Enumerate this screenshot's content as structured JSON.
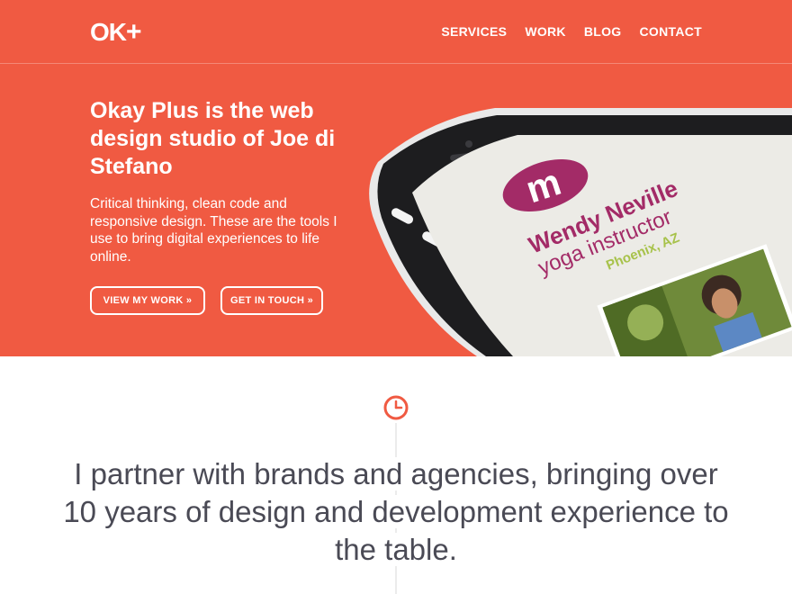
{
  "brand": {
    "logo_text": "OK",
    "logo_plus": "+",
    "accent_color": "#f05a42"
  },
  "nav": {
    "items": [
      "SERVICES",
      "WORK",
      "BLOG",
      "CONTACT"
    ]
  },
  "hero": {
    "headline": "Okay Plus is the web design studio of Joe di Stefano",
    "intro": "Critical thinking, clean code and responsive design. These are the tools I use to bring digital experiences to life online.",
    "buttons": {
      "view_work": "VIEW MY WORK »",
      "get_in_touch": "GET IN TOUCH »"
    }
  },
  "phone_screen": {
    "logo_letter": "m",
    "name": "Wendy Neville",
    "title": "yoga instructor",
    "location": "Phoenix, AZ"
  },
  "icons": {
    "timeline_icon": "clock-icon"
  },
  "statement": "I partner with brands and agencies, bringing over 10 years of design and development experience to the table."
}
